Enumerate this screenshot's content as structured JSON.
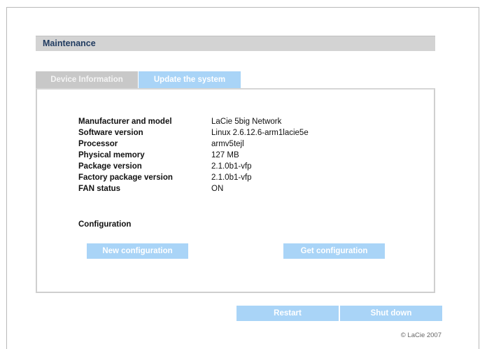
{
  "section": {
    "title": "Maintenance"
  },
  "tabs": [
    {
      "label": "Device Information",
      "active": true
    },
    {
      "label": "Update the system",
      "active": false
    }
  ],
  "device_info": [
    {
      "label": "Manufacturer and model",
      "value": "LaCie 5big Network"
    },
    {
      "label": "Software version",
      "value": "Linux 2.6.12.6-arm1lacie5e"
    },
    {
      "label": "Processor",
      "value": "armv5tejl"
    },
    {
      "label": "Physical memory",
      "value": "127 MB"
    },
    {
      "label": "Package version",
      "value": "2.1.0b1-vfp"
    },
    {
      "label": "Factory package version",
      "value": "2.1.0b1-vfp"
    },
    {
      "label": "FAN status",
      "value": "ON"
    }
  ],
  "configuration": {
    "title": "Configuration",
    "new_label": "New configuration",
    "get_label": "Get configuration"
  },
  "actions": {
    "restart_label": "Restart",
    "shutdown_label": "Shut down"
  },
  "footer": {
    "copyright": "© LaCie 2007"
  },
  "colors": {
    "accent_button": "#a9d4f7",
    "header_bg": "#d3d3d3",
    "header_text": "#1f3a5f"
  }
}
